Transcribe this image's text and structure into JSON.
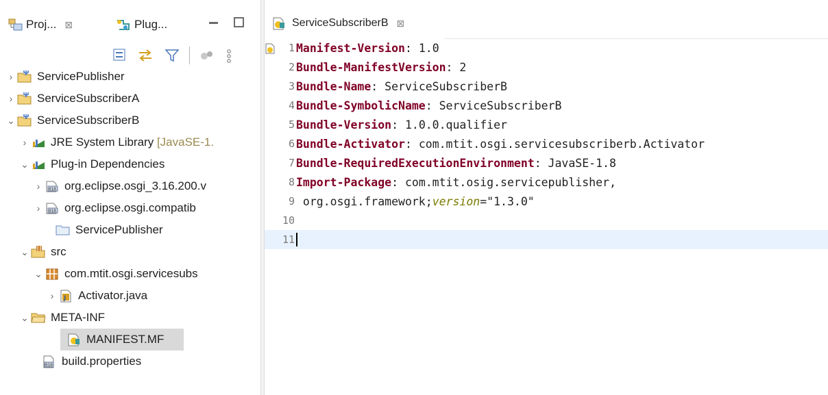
{
  "left_panel": {
    "tabs": [
      {
        "label": "Proj...",
        "close": "⊠"
      },
      {
        "label": "Plug...",
        "close": ""
      }
    ],
    "tree": [
      {
        "label": "ServicePublisher",
        "level": 0,
        "expanded": false,
        "icon": "plugin-project-icon"
      },
      {
        "label": "ServiceSubscriberA",
        "level": 0,
        "expanded": false,
        "icon": "plugin-project-icon"
      },
      {
        "label": "ServiceSubscriberB",
        "level": 0,
        "expanded": true,
        "icon": "plugin-project-icon"
      },
      {
        "label": "JRE System Library",
        "suffix": "[JavaSE-1.",
        "level": 1,
        "expanded": false,
        "icon": "library-icon"
      },
      {
        "label": "Plug-in Dependencies",
        "level": 1,
        "expanded": true,
        "icon": "library-icon"
      },
      {
        "label": "org.eclipse.osgi_3.16.200.v",
        "level": 2,
        "expanded": false,
        "icon": "jar-icon"
      },
      {
        "label": "org.eclipse.osgi.compatib",
        "level": 2,
        "expanded": false,
        "icon": "jar-icon"
      },
      {
        "label": "ServicePublisher",
        "level": 2,
        "expanded": null,
        "icon": "folder-icon"
      },
      {
        "label": "src",
        "level": 1,
        "expanded": true,
        "icon": "source-folder-icon"
      },
      {
        "label": "com.mtit.osgi.servicesubs",
        "level": 2,
        "expanded": true,
        "icon": "package-icon"
      },
      {
        "label": "Activator.java",
        "level": 3,
        "expanded": false,
        "icon": "java-file-icon"
      },
      {
        "label": "META-INF",
        "level": 1,
        "expanded": true,
        "icon": "folder-icon"
      },
      {
        "label": "MANIFEST.MF",
        "level": 2,
        "expanded": null,
        "icon": "manifest-icon",
        "selected": true
      },
      {
        "label": "build.properties",
        "level": 1,
        "expanded": null,
        "icon": "properties-icon"
      }
    ]
  },
  "editor": {
    "tab_title": "ServiceSubscriberB",
    "tab_close": "⊠",
    "lines": [
      {
        "n": "1",
        "key": "Manifest-Version",
        "rest": ": 1.0"
      },
      {
        "n": "2",
        "key": "Bundle-ManifestVersion",
        "rest": ": 2"
      },
      {
        "n": "3",
        "key": "Bundle-Name",
        "rest": ": ServiceSubscriberB"
      },
      {
        "n": "4",
        "key": "Bundle-SymbolicName",
        "rest": ": ServiceSubscriberB"
      },
      {
        "n": "5",
        "key": "Bundle-Version",
        "rest": ": 1.0.0.qualifier"
      },
      {
        "n": "6",
        "key": "Bundle-Activator",
        "rest": ": com.mtit.osgi.servicesubscriberb.Activator"
      },
      {
        "n": "7",
        "key": "Bundle-RequiredExecutionEnvironment",
        "rest": ": JavaSE-1.8"
      },
      {
        "n": "8",
        "key": "Import-Package",
        "rest": ": com.mtit.osig.servicepublisher,"
      },
      {
        "n": "9",
        "key": "",
        "rest": " org.osgi.framework;",
        "attr": "version",
        "tail": "=\"1.3.0\""
      },
      {
        "n": "10",
        "key": "",
        "rest": ""
      },
      {
        "n": "11",
        "key": "",
        "rest": "",
        "current": true
      }
    ]
  }
}
